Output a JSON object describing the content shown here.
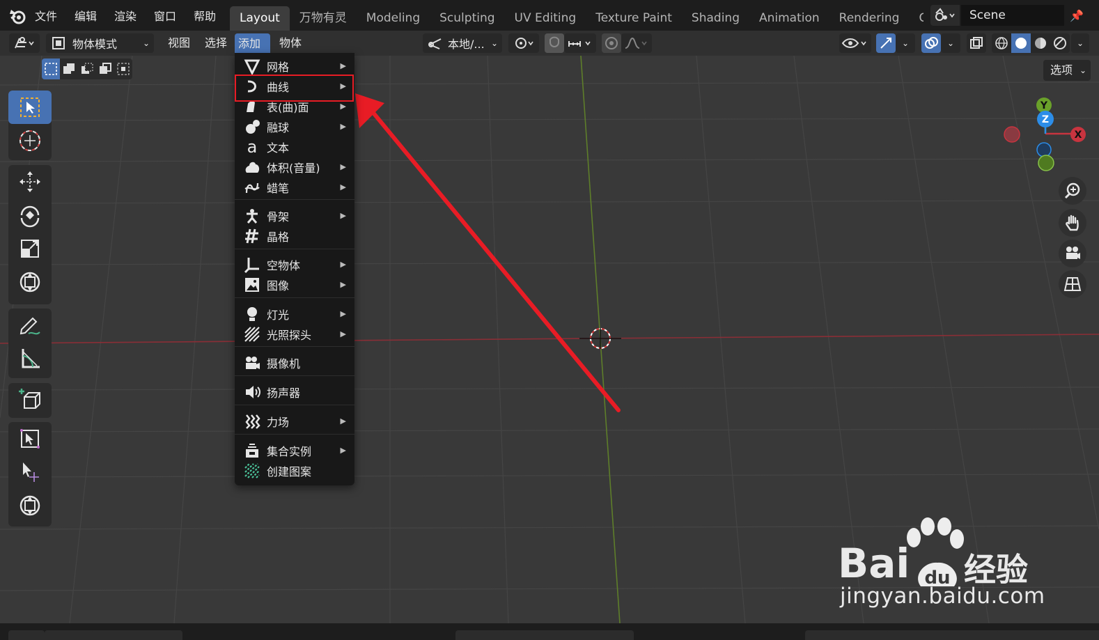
{
  "topbar": {
    "menus": [
      "文件",
      "编辑",
      "渲染",
      "窗口",
      "帮助"
    ],
    "workspace_tabs": [
      "Layout",
      "万物有灵",
      "Modeling",
      "Sculpting",
      "UV Editing",
      "Texture Paint",
      "Shading",
      "Animation",
      "Rendering",
      "Compo"
    ],
    "active_tab": "Layout",
    "scene_name": "Scene"
  },
  "viewport_header": {
    "mode": "物体模式",
    "menus": [
      "视图",
      "选择",
      "添加",
      "物体"
    ],
    "active_menu": "添加",
    "transform_orientation": "本地/...",
    "options_label": "选项"
  },
  "add_menu": {
    "items": [
      {
        "label": "网格",
        "icon": "mesh-icon",
        "submenu": true
      },
      {
        "label": "曲线",
        "icon": "curve-icon",
        "submenu": true
      },
      {
        "label": "表(曲)面",
        "icon": "surface-icon",
        "submenu": true
      },
      {
        "label": "融球",
        "icon": "metaball-icon",
        "submenu": true
      },
      {
        "label": "文本",
        "icon": "text-icon",
        "submenu": false
      },
      {
        "label": "体积(音量)",
        "icon": "volume-icon",
        "submenu": true
      },
      {
        "label": "蜡笔",
        "icon": "grease-pencil-icon",
        "submenu": true
      },
      {
        "label": "骨架",
        "icon": "armature-icon",
        "submenu": true
      },
      {
        "label": "晶格",
        "icon": "lattice-icon",
        "submenu": false
      },
      {
        "label": "空物体",
        "icon": "empty-icon",
        "submenu": true
      },
      {
        "label": "图像",
        "icon": "image-icon",
        "submenu": true
      },
      {
        "label": "灯光",
        "icon": "light-icon",
        "submenu": true
      },
      {
        "label": "光照探头",
        "icon": "light-probe-icon",
        "submenu": true
      },
      {
        "label": "摄像机",
        "icon": "camera-icon",
        "submenu": false
      },
      {
        "label": "扬声器",
        "icon": "speaker-icon",
        "submenu": false
      },
      {
        "label": "力场",
        "icon": "force-field-icon",
        "submenu": true
      },
      {
        "label": "集合实例",
        "icon": "collection-instance-icon",
        "submenu": true
      },
      {
        "label": "创建图案",
        "icon": "create-pattern-icon",
        "submenu": false
      }
    ],
    "highlighted_item": "曲线"
  },
  "gizmo": {
    "x": "X",
    "y": "Y",
    "z": "Z"
  },
  "watermark": {
    "brand": "Bai",
    "product": "经验",
    "url": "jingyan.baidu.com"
  },
  "colors": {
    "accent": "#4772b3",
    "highlight": "#e81c25",
    "x_axis": "#c8343f",
    "y_axis": "#6aa12a",
    "z_axis": "#2c8de8"
  }
}
